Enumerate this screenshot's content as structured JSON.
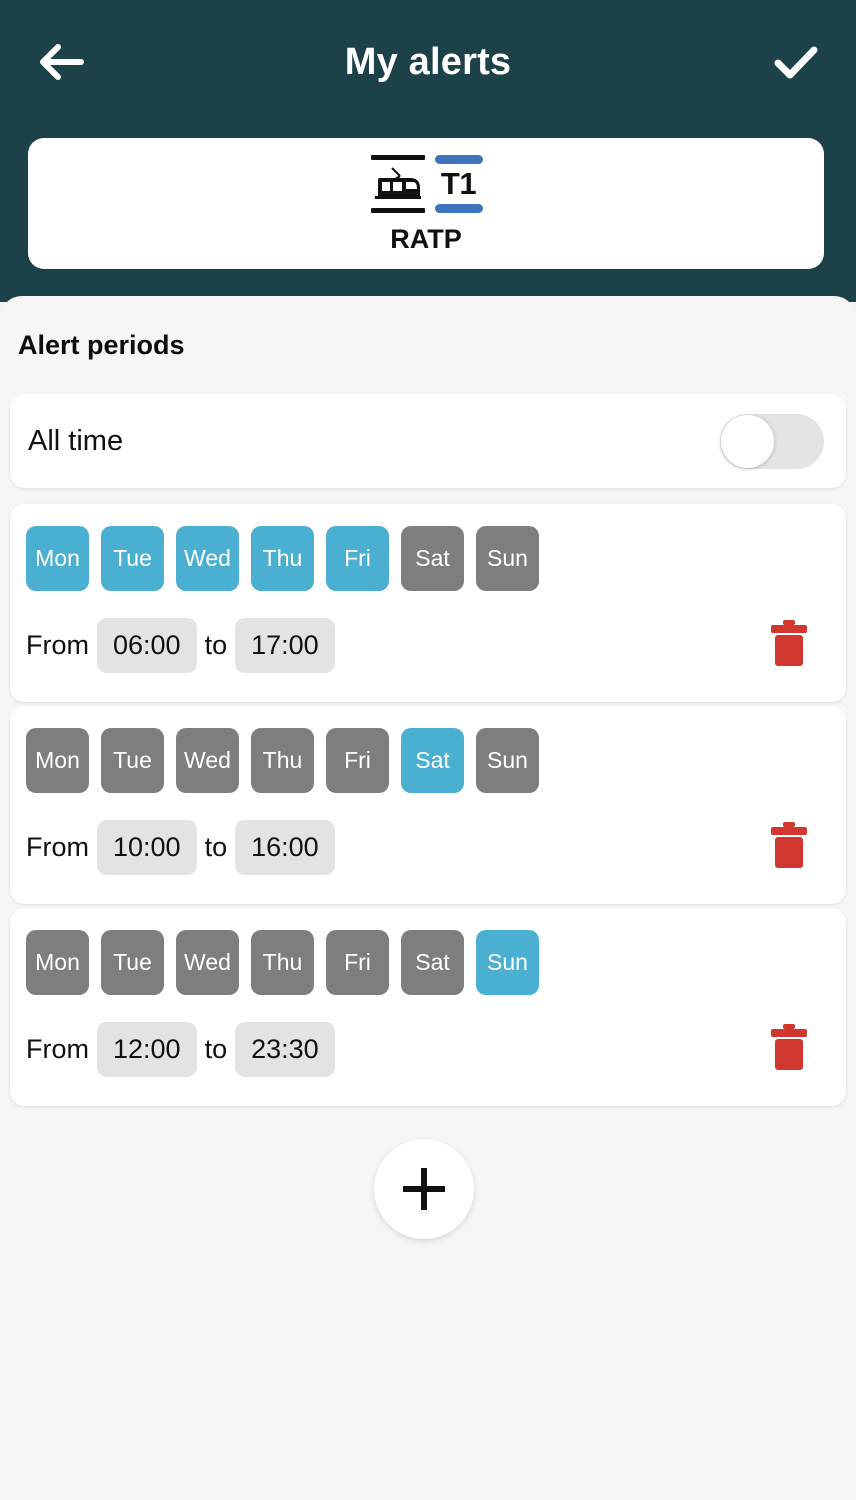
{
  "header": {
    "title": "My alerts",
    "back_icon": "arrow-left-icon",
    "confirm_icon": "check-icon"
  },
  "route": {
    "mode_icon": "tram-icon",
    "line_label": "T1",
    "operator": "RATP"
  },
  "sheet": {
    "section_title": "Alert periods",
    "all_time": {
      "label": "All time",
      "enabled": false
    },
    "day_labels": [
      "Mon",
      "Tue",
      "Wed",
      "Thu",
      "Fri",
      "Sat",
      "Sun"
    ],
    "from_label": "From",
    "to_label": "to",
    "delete_icon": "trash-icon",
    "add_icon": "plus-icon",
    "periods": [
      {
        "days_active": [
          true,
          true,
          true,
          true,
          true,
          false,
          false
        ],
        "from": "06:00",
        "to": "17:00"
      },
      {
        "days_active": [
          false,
          false,
          false,
          false,
          false,
          true,
          false
        ],
        "from": "10:00",
        "to": "16:00"
      },
      {
        "days_active": [
          false,
          false,
          false,
          false,
          false,
          false,
          true
        ],
        "from": "12:00",
        "to": "23:30"
      }
    ]
  },
  "colors": {
    "header_bg": "#1c4148",
    "day_active": "#4aafd0",
    "day_inactive": "#7e7e7e",
    "delete_red": "#d0382f",
    "line_blue": "#3d74bd",
    "sheet_bg": "#f6f6f6"
  }
}
